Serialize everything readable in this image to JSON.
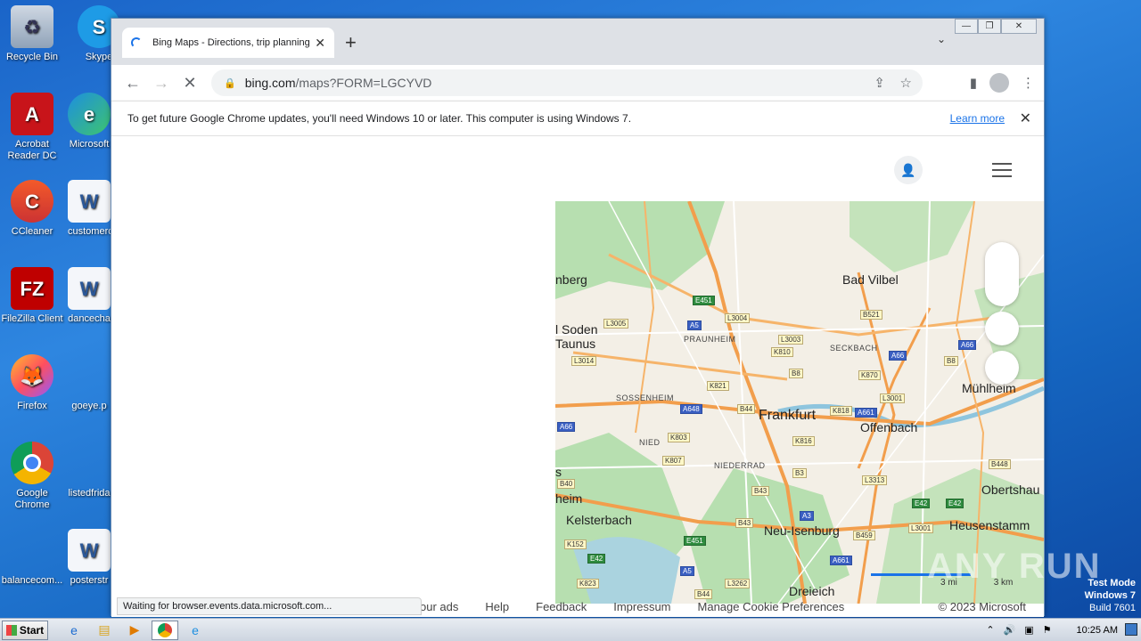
{
  "desktop": {
    "icons": [
      {
        "label": "Recycle Bin"
      },
      {
        "label": "Skype"
      },
      {
        "label": "Acrobat Reader DC"
      },
      {
        "label": "Microsoft"
      },
      {
        "label": "CCleaner"
      },
      {
        "label": "customerc"
      },
      {
        "label": "FileZilla Client"
      },
      {
        "label": "dancecha"
      },
      {
        "label": "Firefox"
      },
      {
        "label": "goeye.p"
      },
      {
        "label": "Google Chrome"
      },
      {
        "label": "listedfrida"
      },
      {
        "label": "balancecom..."
      },
      {
        "label": "posterstr"
      }
    ]
  },
  "browser": {
    "tab_title": "Bing Maps - Directions, trip planning",
    "url_host": "bing.com",
    "url_path": "/maps?FORM=LGCYVD",
    "infobar_text": "To get future Google Chrome updates, you'll need Windows 10 or later. This computer is using Windows 7.",
    "infobar_link": "Learn more",
    "status_text": "Waiting for browser.events.data.microsoft.com..."
  },
  "map": {
    "labels": {
      "frankfurt": "Frankfurt",
      "offenbach": "Offenbach",
      "neu_isenburg": "Neu-Isenburg",
      "kelsterbach": "Kelsterbach",
      "heusenstamm": "Heusenstamm",
      "obertshausen": "Obertshau",
      "muhlheim": "Mühlheim",
      "bad_vilbel": "Bad Vilbel",
      "bad_soden": "l Soden",
      "taunus": "Taunus",
      "dreieich": "Dreieich",
      "praunheim": "PRAUNHEIM",
      "seckbach": "SECKBACH",
      "sossenheim": "SOSSENHEIM",
      "nied": "NIED",
      "niederrad": "NIEDERRAD",
      "heim": "heim",
      "s": "s",
      "nberg": "nberg"
    },
    "scale_mi": "3 mi",
    "scale_km": "3 km"
  },
  "footer": {
    "links": [
      "our ads",
      "Help",
      "Feedback",
      "Impressum",
      "Manage Cookie Preferences"
    ],
    "copyright": "© 2023 Microsoft"
  },
  "watermark": "ANY RUN",
  "test_mode": {
    "line1": "Test Mode",
    "line2": "Windows 7",
    "line3": "Build 7601"
  },
  "taskbar": {
    "start_label": "Start",
    "clock": "10:25 AM"
  }
}
